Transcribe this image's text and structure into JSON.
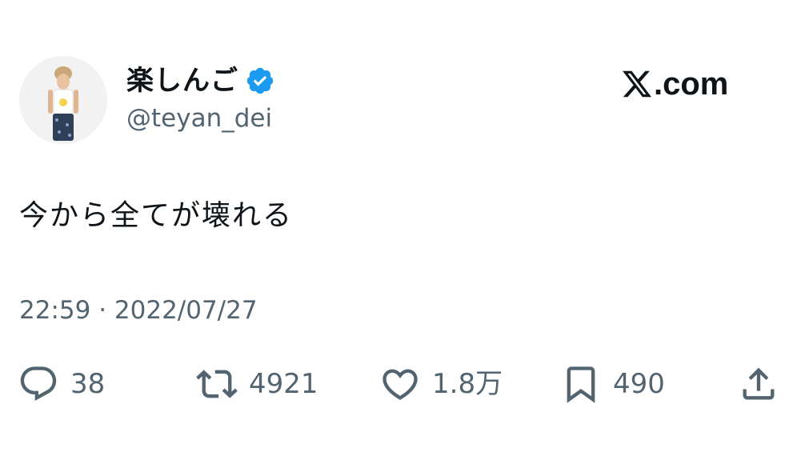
{
  "author": {
    "display_name": "楽しんご",
    "handle": "@teyan_dei",
    "verified": true,
    "avatar_icon": "user-avatar"
  },
  "brand": {
    "text": ".com",
    "logo_icon": "x-logo-icon"
  },
  "tweet": {
    "text": "今から全てが壊れる",
    "timestamp": "22:59 · 2022/07/27"
  },
  "actions": {
    "reply_count": "38",
    "retweet_count": "4921",
    "like_count": "1.8万",
    "bookmark_count": "490",
    "share_icon": "share-icon"
  },
  "colors": {
    "text_primary": "#0f1419",
    "text_secondary": "#536471",
    "verified_blue": "#1d9bf0",
    "background": "#ffffff"
  }
}
